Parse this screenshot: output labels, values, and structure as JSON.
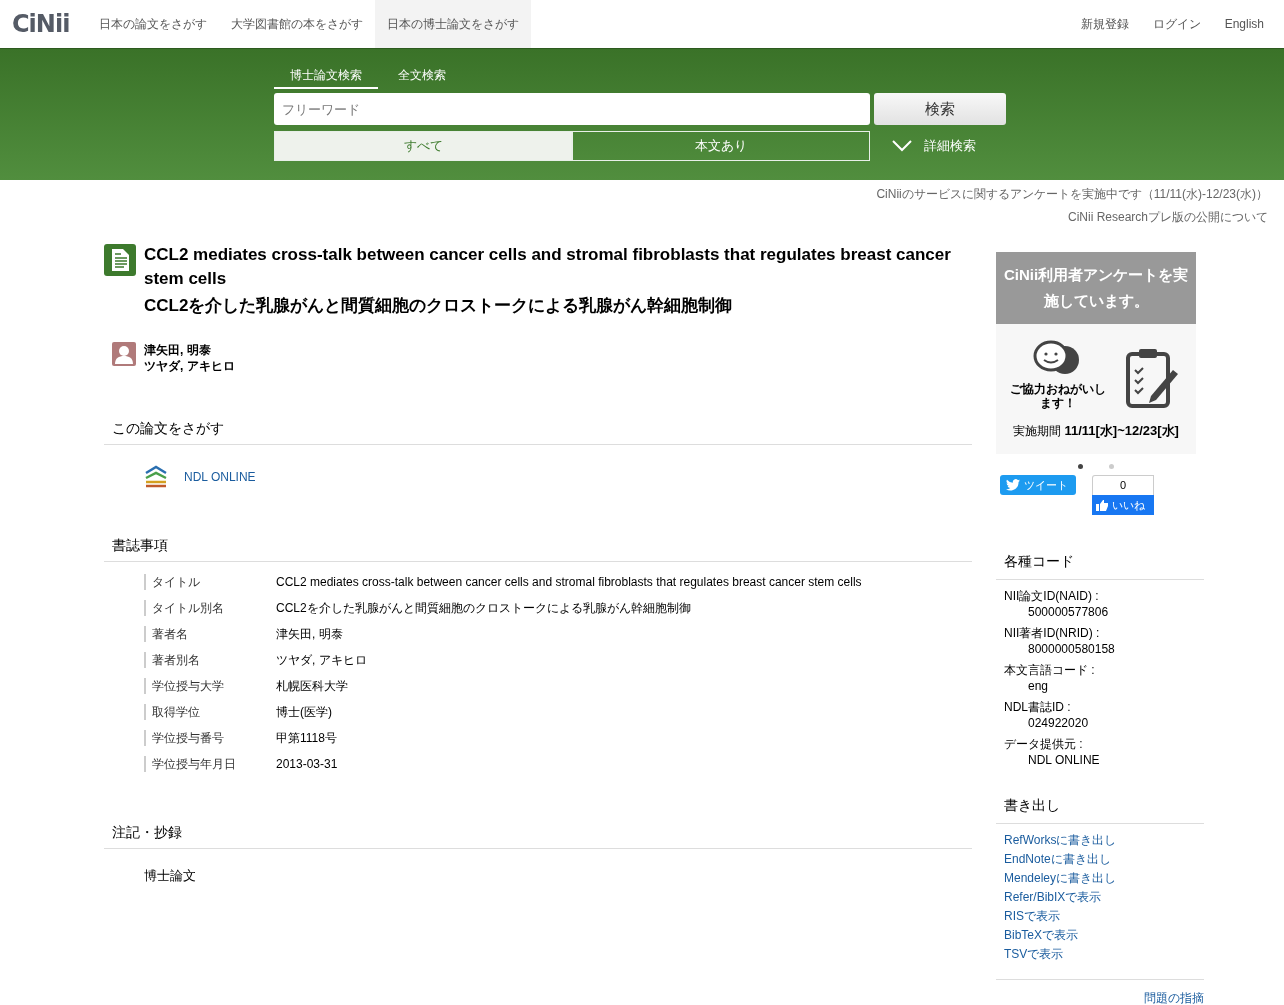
{
  "nav": {
    "logo": "CiNii",
    "items": [
      {
        "label": "日本の論文をさがす",
        "selected": false
      },
      {
        "label": "大学図書館の本をさがす",
        "selected": false
      },
      {
        "label": "日本の博士論文をさがす",
        "selected": true
      }
    ],
    "right_links": [
      "新規登録",
      "ログイン",
      "English"
    ]
  },
  "search": {
    "tabs": [
      {
        "label": "博士論文検索",
        "selected": true
      },
      {
        "label": "全文検索",
        "selected": false
      }
    ],
    "placeholder": "フリーワード",
    "button": "検索",
    "filters": [
      {
        "label": "すべて",
        "selected": true
      },
      {
        "label": "本文あり",
        "selected": false
      }
    ],
    "advanced": "詳細検索"
  },
  "notices": [
    "CiNiiのサービスに関するアンケートを実施中です（11/11(水)-12/23(水)）",
    "CiNii Researchプレ版の公開について"
  ],
  "article": {
    "title": "CCL2 mediates cross-talk between cancer cells and stromal fibroblasts that regulates breast cancer stem cells",
    "title_alt": "CCL2を介した乳腺がんと間質細胞のクロストークによる乳腺がん幹細胞制御",
    "author": {
      "name": "津矢田, 明泰",
      "kana": "ツヤダ, アキヒロ"
    }
  },
  "find_section": {
    "heading": "この論文をさがす",
    "link": "NDL ONLINE"
  },
  "bib_section": {
    "heading": "書誌事項",
    "rows": [
      {
        "label": "タイトル",
        "value": "CCL2 mediates cross-talk between cancer cells and stromal fibroblasts that regulates breast cancer stem cells"
      },
      {
        "label": "タイトル別名",
        "value": "CCL2を介した乳腺がんと間質細胞のクロストークによる乳腺がん幹細胞制御"
      },
      {
        "label": "著者名",
        "value": "津矢田, 明泰"
      },
      {
        "label": "著者別名",
        "value": "ツヤダ, アキヒロ"
      },
      {
        "label": "学位授与大学",
        "value": "札幌医科大学"
      },
      {
        "label": "取得学位",
        "value": "博士(医学)"
      },
      {
        "label": "学位授与番号",
        "value": "甲第1118号"
      },
      {
        "label": "学位授与年月日",
        "value": "2013-03-31"
      }
    ]
  },
  "notes_section": {
    "heading": "注記・抄録",
    "text": "博士論文"
  },
  "banner": {
    "headline": "CiNii利用者アンケートを実施しています。",
    "caption": "ご協力おねがいします！",
    "period_label": "実施期間",
    "period": "11/11[水]~12/23[水]",
    "dots": [
      {
        "selected": true
      },
      {
        "selected": false
      }
    ]
  },
  "social": {
    "tweet": "ツイート",
    "like_count": "0",
    "like": "いいね"
  },
  "codes_section": {
    "heading": "各種コード",
    "items": [
      {
        "label": "NII論文ID(NAID) :",
        "value": "500000577806"
      },
      {
        "label": "NII著者ID(NRID) :",
        "value": "8000000580158"
      },
      {
        "label": "本文言語コード :",
        "value": "eng"
      },
      {
        "label": "NDL書誌ID :",
        "value": "024922020"
      },
      {
        "label": "データ提供元 :",
        "value": "NDL ONLINE"
      }
    ]
  },
  "export_section": {
    "heading": "書き出し",
    "links": [
      "RefWorksに書き出し",
      "EndNoteに書き出し",
      "Mendeleyに書き出し",
      "Refer/BibIXで表示",
      "RISで表示",
      "BibTeXで表示",
      "TSVで表示"
    ]
  },
  "report_link": "問題の指摘"
}
